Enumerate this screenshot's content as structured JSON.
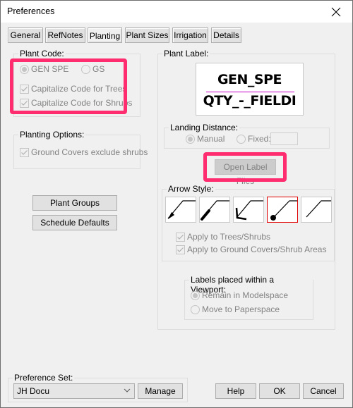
{
  "window": {
    "title": "Preferences",
    "close_icon": "close-icon"
  },
  "tabs": [
    {
      "label": "General",
      "active": false
    },
    {
      "label": "RefNotes",
      "active": false
    },
    {
      "label": "Planting",
      "active": true
    },
    {
      "label": "Plant Sizes",
      "active": false
    },
    {
      "label": "Irrigation",
      "active": false
    },
    {
      "label": "Details",
      "active": false
    }
  ],
  "plant_code": {
    "group_label": "Plant Code:",
    "radio_gen_spe": "GEN SPE",
    "radio_gs": "GS",
    "selected": "GEN SPE",
    "check_trees": "Capitalize Code for Trees",
    "check_shrubs": "Capitalize Code for Shrubs",
    "trees_checked": true,
    "shrubs_checked": true
  },
  "planting_options": {
    "group_label": "Planting Options:",
    "check_ground_covers": "Ground Covers exclude shrubs",
    "ground_covers_checked": true
  },
  "buttons_left": {
    "plant_groups": "Plant Groups",
    "schedule_defaults": "Schedule Defaults"
  },
  "plant_label": {
    "group_label": "Plant Label:",
    "preview_line1": "GEN_SPE",
    "preview_line2": "QTY_-_FIELDI",
    "rule_color": "#c800c8"
  },
  "landing_distance": {
    "group_label": "Landing Distance:",
    "radio_manual": "Manual",
    "radio_fixed": "Fixed:",
    "selected": "Manual",
    "fixed_value": ""
  },
  "open_label_files": "Open Label Files",
  "arrow_style": {
    "group_label": "Arrow Style:",
    "styles": [
      {
        "name": "arrowhead-filled",
        "selected": false
      },
      {
        "name": "arrowhead-tick",
        "selected": false
      },
      {
        "name": "arrowhead-open",
        "selected": false
      },
      {
        "name": "dot",
        "selected": true
      },
      {
        "name": "none",
        "selected": false
      }
    ],
    "apply_trees": "Apply to Trees/Shrubs",
    "apply_ground": "Apply to Ground Covers/Shrub Areas",
    "apply_trees_checked": true,
    "apply_ground_checked": true
  },
  "viewport": {
    "group_label": "Labels placed within a Viewport:",
    "radio_modelspace": "Remain in Modelspace",
    "radio_paperspace": "Move to Paperspace",
    "selected": "Remain in Modelspace"
  },
  "preference_set": {
    "group_label": "Preference Set:",
    "value": "JH Docu",
    "manage": "Manage"
  },
  "footer": {
    "help": "Help",
    "ok": "OK",
    "cancel": "Cancel"
  },
  "colors": {
    "highlight": "#ff2d6f",
    "selected_tile_border": "#e00000"
  }
}
